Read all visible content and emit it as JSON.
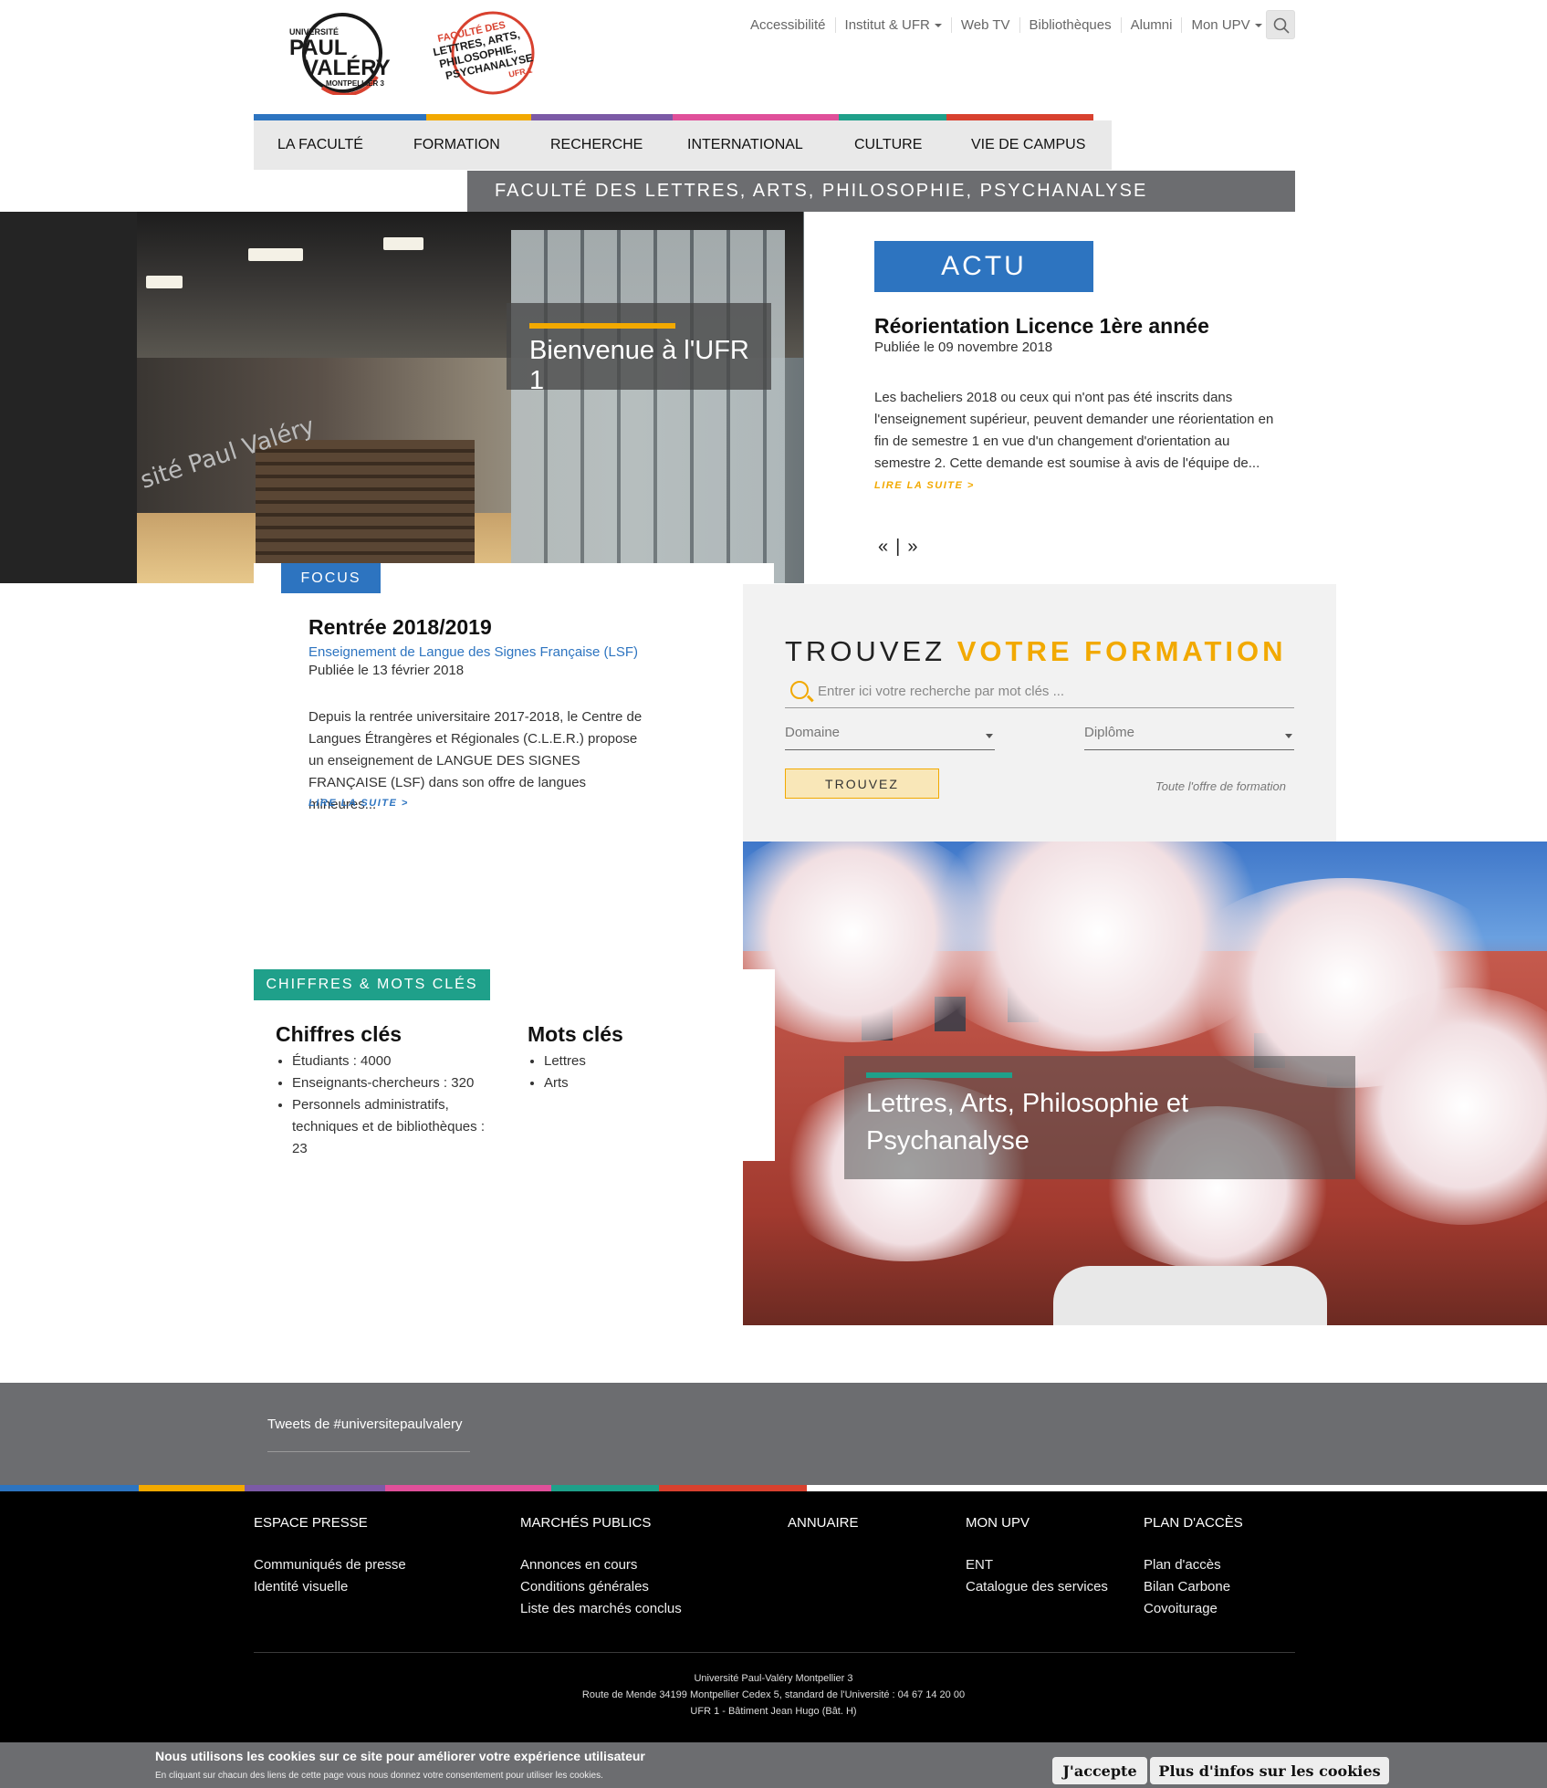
{
  "top_nav": {
    "items": [
      "Accessibilité",
      "Institut & UFR",
      "Web TV",
      "Bibliothèques",
      "Alumni",
      "Mon UPV"
    ],
    "search_icon": "search-icon"
  },
  "logos": {
    "university": {
      "line1": "UNIVERSITÉ",
      "line2": "PAUL",
      "line3": "VALÉRY",
      "line4": "MONTPELLIER 3"
    },
    "faculty": {
      "line1": "FACULTÉ DES",
      "line2": "LETTRES, ARTS,",
      "line3": "PHILOSOPHIE,",
      "line4": "PSYCHANALYSE",
      "line5": "UFR 1"
    }
  },
  "colors": {
    "blue": "#2d74c0",
    "yellow": "#f2a900",
    "purple": "#7c5aa6",
    "pink": "#e0509a",
    "teal": "#1fa08a",
    "red": "#d8412f",
    "grey": "#6c6d70"
  },
  "main_nav": {
    "items": [
      "LA FACULTÉ",
      "FORMATION",
      "RECHERCHE",
      "INTERNATIONAL",
      "CULTURE",
      "VIE DE CAMPUS"
    ]
  },
  "faculty_banner": "FACULTÉ DES LETTRES, ARTS, PHILOSOPHIE, PSYCHANALYSE",
  "hero": {
    "caption": "Bienvenue à l'UFR 1",
    "wall_text": "sité Paul Valéry"
  },
  "actu": {
    "badge": "ACTU",
    "title": "Réorientation Licence 1ère année",
    "date": "Publiée le 09 novembre 2018",
    "body": "Les bacheliers 2018 ou ceux qui n'ont pas été inscrits  dans l'enseignement supérieur, peuvent demander une réorientation en fin de semestre 1 en vue d'un changement d'orientation au semestre 2. Cette demande est soumise à avis de l'équipe de...",
    "read_more": "LIRE LA SUITE  >",
    "prev": "«",
    "separator": "|",
    "next": "»"
  },
  "focus": {
    "badge": "FOCUS",
    "title": "Rentrée 2018/2019",
    "subtitle": "Enseignement de Langue des Signes Française (LSF)",
    "date": "Publiée le 13 février 2018",
    "body": "Depuis la rentrée universitaire 2017-2018, le Centre de Langues Étrangères et Régionales (C.L.E.R.) propose un enseignement de LANGUE DES SIGNES FRANÇAISE (LSF) dans son offre de langues mineures...",
    "read_more": "LIRE LA SUITE  >"
  },
  "formation": {
    "title_plain": "TROUVEZ",
    "title_accent": "VOTRE FORMATION",
    "search_placeholder": "Entrer ici votre recherche par mot clés ...",
    "domain_label": "Domaine",
    "diploma_label": "Diplôme",
    "button": "TROUVEZ",
    "all_link": "Toute l'offre de formation"
  },
  "blossom": {
    "caption": "Lettres, Arts, Philosophie et Psychanalyse"
  },
  "chiffres": {
    "badge": "CHIFFRES & MOTS CLÉS",
    "figures_title": "Chiffres clés",
    "figures": [
      "Étudiants : 4000",
      "Enseignants-chercheurs : 320",
      "Personnels administratifs, techniques et de bibliothèques : 23"
    ],
    "keywords_title": "Mots clés",
    "keywords": [
      "Lettres",
      "Arts"
    ]
  },
  "tweets": {
    "label": "Tweets de #universitepaulvalery"
  },
  "footer": {
    "columns": [
      {
        "heading": "ESPACE PRESSE",
        "links": [
          "Communiqués de presse",
          "Identité visuelle"
        ]
      },
      {
        "heading": "MARCHÉS PUBLICS",
        "links": [
          "Annonces en cours",
          "Conditions générales",
          "Liste des marchés conclus"
        ]
      },
      {
        "heading": "ANNUAIRE",
        "links": []
      },
      {
        "heading": "MON UPV",
        "links": [
          "ENT",
          "Catalogue des services"
        ]
      },
      {
        "heading": "PLAN D'ACCÈS",
        "links": [
          "Plan d'accès",
          "Bilan Carbone",
          "Covoiturage"
        ]
      }
    ],
    "address": [
      "Université Paul-Valéry Montpellier 3",
      "Route de Mende 34199 Montpellier Cedex 5, standard de l'Université : 04 67 14 20 00",
      "UFR 1 - Bâtiment Jean Hugo (Bât. H)"
    ]
  },
  "cookie": {
    "title": "Nous utilisons les cookies sur ce site pour améliorer votre expérience utilisateur",
    "subtitle": "En cliquant sur chacun des liens de cette page vous nous donnez votre consentement pour utiliser les cookies.",
    "accept": "J'accepte",
    "more": "Plus d'infos sur les cookies"
  }
}
